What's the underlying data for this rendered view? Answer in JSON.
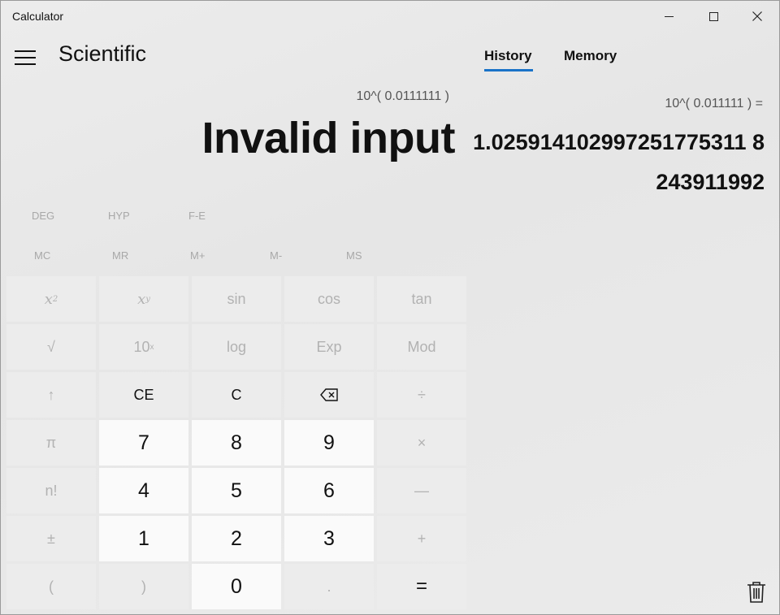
{
  "window": {
    "title": "Calculator"
  },
  "header": {
    "mode": "Scientific"
  },
  "tabs": [
    {
      "label": "History",
      "active": true
    },
    {
      "label": "Memory",
      "active": false
    }
  ],
  "display": {
    "expression": "10^( 0.0111111 )",
    "result": "Invalid input"
  },
  "history": {
    "expression": "10^( 0.011111 ) =",
    "result": "1.025914102997251775311 8243911992"
  },
  "toggles": {
    "angle": "DEG",
    "hyp": "HYP",
    "fe": "F-E"
  },
  "memory_buttons": [
    "MC",
    "MR",
    "M+",
    "M-",
    "MS"
  ],
  "keys": {
    "x2": "x",
    "x2_sup": "2",
    "xy": "x",
    "xy_sup": "y",
    "sin": "sin",
    "cos": "cos",
    "tan": "tan",
    "sqrt": "√",
    "tenx": "10",
    "tenx_sup": "x",
    "log": "log",
    "exp": "Exp",
    "mod": "Mod",
    "up": "↑",
    "ce": "CE",
    "c": "C",
    "backspace": "⌫",
    "divide": "÷",
    "pi": "π",
    "seven": "7",
    "eight": "8",
    "nine": "9",
    "multiply": "×",
    "fact": "n!",
    "four": "4",
    "five": "5",
    "six": "6",
    "minus": "—",
    "negate": "±",
    "one": "1",
    "two": "2",
    "three": "3",
    "plus": "+",
    "lparen": "(",
    "rparen": ")",
    "zero": "0",
    "dot": ".",
    "equals": "="
  },
  "colors": {
    "accent": "#1a73c8"
  }
}
